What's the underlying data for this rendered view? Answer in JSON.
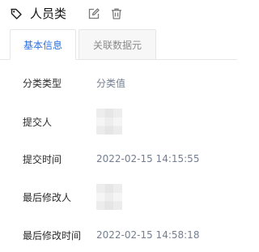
{
  "header": {
    "title": "人员类",
    "tag_icon": "tag-icon",
    "edit_icon": "edit-icon",
    "delete_icon": "delete-icon"
  },
  "tabs": [
    {
      "label": "基本信息",
      "active": true
    },
    {
      "label": "关联数据元",
      "active": false
    }
  ],
  "details": {
    "category_type": {
      "label": "分类类型",
      "value": "分类值"
    },
    "submitter": {
      "label": "提交人"
    },
    "submit_time": {
      "label": "提交时间",
      "value": "2022-02-15 14:15:55"
    },
    "last_modifier": {
      "label": "最后修改人"
    },
    "last_modified_time": {
      "label": "最后修改时间",
      "value": "2022-02-15 14:58:18"
    }
  },
  "colors": {
    "active_tab_text": "#2a6fe0",
    "inactive_tab_text": "#8a8a8a",
    "value_text": "#737f91",
    "label_text": "#2b2b2b"
  }
}
